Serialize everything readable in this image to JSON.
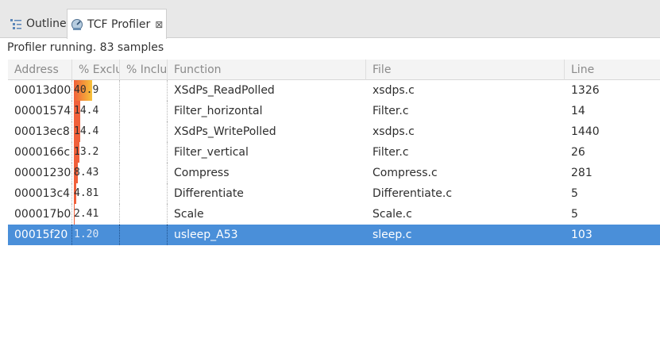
{
  "tabs": [
    {
      "label": "Outline",
      "icon": "outline-icon",
      "active": false
    },
    {
      "label": "TCF Profiler",
      "icon": "profiler-icon",
      "active": true,
      "close_glyph": "⊠"
    }
  ],
  "status": "Profiler running. 83 samples",
  "columns": [
    "Address",
    "% Exclu",
    "% Inclu",
    "Function",
    "File",
    "Line"
  ],
  "rows": [
    {
      "address": "00013d00",
      "excl": "40.9",
      "excl_fraction": 0.409,
      "incl": "",
      "function": "XSdPs_ReadPolled",
      "file": "xsdps.c",
      "line": "1326",
      "selected": false
    },
    {
      "address": "00001574",
      "excl": "14.4",
      "excl_fraction": 0.144,
      "incl": "",
      "function": "Filter_horizontal",
      "file": "Filter.c",
      "line": "14",
      "selected": false
    },
    {
      "address": "00013ec8",
      "excl": "14.4",
      "excl_fraction": 0.144,
      "incl": "",
      "function": "XSdPs_WritePolled",
      "file": "xsdps.c",
      "line": "1440",
      "selected": false
    },
    {
      "address": "0000166c",
      "excl": "13.2",
      "excl_fraction": 0.132,
      "incl": "",
      "function": "Filter_vertical",
      "file": "Filter.c",
      "line": "26",
      "selected": false
    },
    {
      "address": "00001230",
      "excl": "8.43",
      "excl_fraction": 0.0843,
      "incl": "",
      "function": "Compress",
      "file": "Compress.c",
      "line": "281",
      "selected": false
    },
    {
      "address": "000013c4",
      "excl": "4.81",
      "excl_fraction": 0.0481,
      "incl": "",
      "function": "Differentiate",
      "file": "Differentiate.c",
      "line": "5",
      "selected": false
    },
    {
      "address": "000017b0",
      "excl": "2.41",
      "excl_fraction": 0.0241,
      "incl": "",
      "function": "Scale",
      "file": "Scale.c",
      "line": "5",
      "selected": false
    },
    {
      "address": "00015f20",
      "excl": "1.20",
      "excl_fraction": 0.012,
      "incl": "",
      "function": "usleep_A53",
      "file": "sleep.c",
      "line": "103",
      "selected": true
    }
  ],
  "colors": {
    "selection": "#4a8fd9",
    "bar_hot": "#f0603a",
    "bar_warm": "#f7c23a"
  }
}
